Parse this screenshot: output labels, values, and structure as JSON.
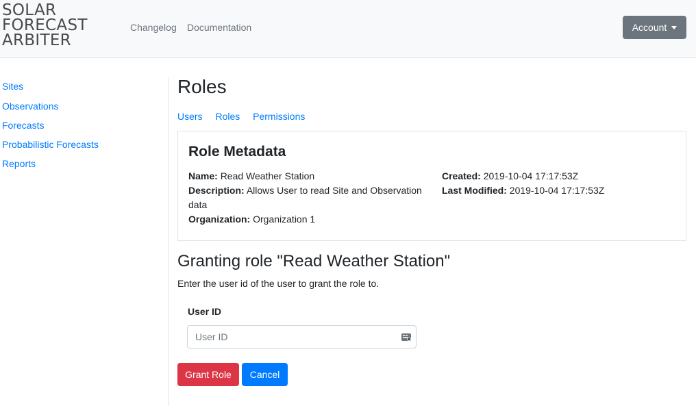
{
  "header": {
    "brand_line1": "SOLAR",
    "brand_line2": "FORECAST",
    "brand_line3": "ARBITER",
    "nav": {
      "changelog": "Changelog",
      "documentation": "Documentation"
    },
    "account_label": "Account"
  },
  "sidebar": {
    "items": [
      {
        "label": "Sites"
      },
      {
        "label": "Observations"
      },
      {
        "label": "Forecasts"
      },
      {
        "label": "Probabilistic Forecasts"
      },
      {
        "label": "Reports"
      }
    ]
  },
  "main": {
    "title": "Roles",
    "tabs": [
      {
        "label": "Users"
      },
      {
        "label": "Roles"
      },
      {
        "label": "Permissions"
      }
    ],
    "metadata": {
      "heading": "Role Metadata",
      "name_label": "Name:",
      "name_value": "Read Weather Station",
      "description_label": "Description:",
      "description_value": "Allows User to read Site and Observation data",
      "organization_label": "Organization:",
      "organization_value": "Organization 1",
      "created_label": "Created:",
      "created_value": "2019-10-04 17:17:53Z",
      "modified_label": "Last Modified:",
      "modified_value": "2019-10-04 17:17:53Z"
    },
    "grant": {
      "heading": "Granting role \"Read Weather Station\"",
      "description": "Enter the user id of the user to grant the role to.",
      "field_label": "User ID",
      "field_placeholder": "User ID",
      "field_value": "",
      "grant_button": "Grant Role",
      "cancel_button": "Cancel"
    }
  },
  "colors": {
    "link": "#007bff",
    "danger": "#dc3545",
    "primary": "#007bff",
    "secondary": "#6c757d",
    "navbar_bg": "#f8f9fa"
  },
  "icons": {
    "input_icon": "id-card-icon",
    "account_caret": "caret-down-icon"
  }
}
